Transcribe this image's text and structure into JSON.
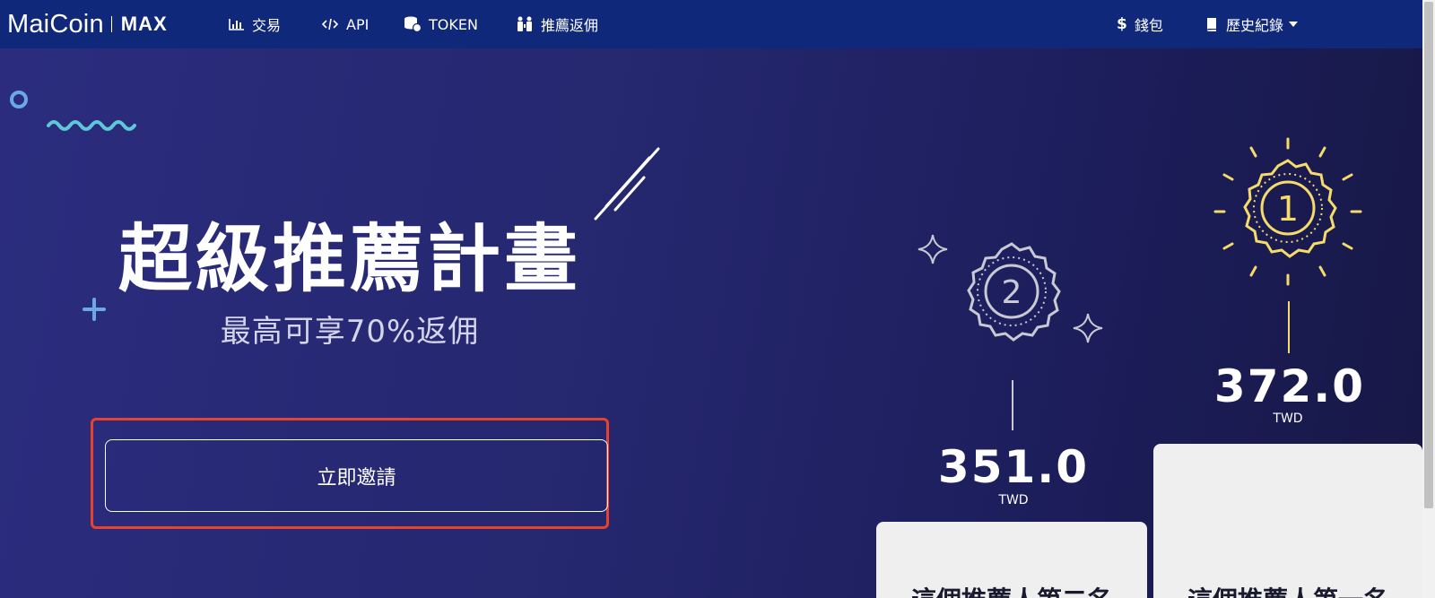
{
  "brand": {
    "name": "MaiCoin",
    "product": "MAX"
  },
  "nav": {
    "items": [
      {
        "label": "交易",
        "icon": "bar-chart-icon"
      },
      {
        "label": "API",
        "icon": "code-icon"
      },
      {
        "label": "TOKEN",
        "icon": "coins-icon"
      },
      {
        "label": "推薦返佣",
        "icon": "users-icon"
      }
    ],
    "right": [
      {
        "label": "錢包",
        "icon": "dollar-icon"
      },
      {
        "label": "歷史紀錄",
        "icon": "book-icon"
      }
    ]
  },
  "hero": {
    "title": "超級推薦計畫",
    "subtitle": "最高可享70%返佣",
    "invite_button": "立即邀請"
  },
  "ranking": {
    "first": {
      "rank": "1",
      "amount": "372.0",
      "currency": "TWD",
      "card_text": "這個推薦人第一名"
    },
    "second": {
      "rank": "2",
      "amount": "351.0",
      "currency": "TWD",
      "card_text": "這個推薦人第二名"
    }
  },
  "colors": {
    "navbar": "#10287a",
    "highlight": "#e8412c",
    "gold": "#f5dc6a",
    "silver": "#c9c9d4"
  }
}
